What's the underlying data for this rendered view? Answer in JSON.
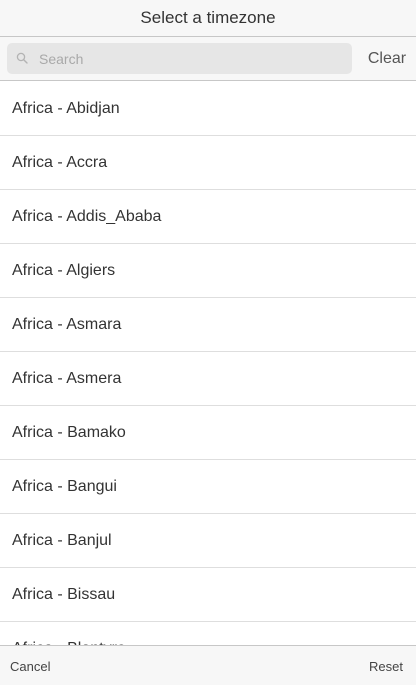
{
  "header": {
    "title": "Select a timezone"
  },
  "search": {
    "placeholder": "Search",
    "value": "",
    "clear_label": "Clear",
    "icon": "search-icon"
  },
  "list": {
    "items": [
      "Africa - Abidjan",
      "Africa - Accra",
      "Africa - Addis_Ababa",
      "Africa - Algiers",
      "Africa - Asmara",
      "Africa - Asmera",
      "Africa - Bamako",
      "Africa - Bangui",
      "Africa - Banjul",
      "Africa - Bissau",
      "Africa - Blantyre"
    ]
  },
  "footer": {
    "cancel_label": "Cancel",
    "reset_label": "Reset"
  },
  "colors": {
    "bar_background": "#f7f7f7",
    "search_field": "#e6e6e6",
    "divider": "#dedede",
    "text": "#333333"
  }
}
